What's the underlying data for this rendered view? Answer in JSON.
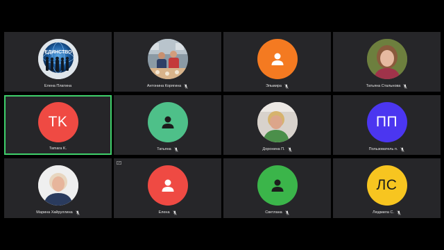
{
  "participants": [
    {
      "name": "Елена Платина",
      "avatar": "photo",
      "photo_desc": "logo-edinstvo",
      "muted": false
    },
    {
      "name": "Антонина Корягина",
      "avatar": "photo",
      "photo_desc": "people-at-table",
      "muted": true
    },
    {
      "name": "Эльмира",
      "avatar": "person-icon",
      "color": "#f47a21",
      "muted": true
    },
    {
      "name": "Татьяна Стальнова",
      "avatar": "photo",
      "photo_desc": "woman-portrait",
      "muted": true
    },
    {
      "name": "Tamara K.",
      "avatar": "initials",
      "initials": "TK",
      "color": "#ef4a43",
      "muted": false,
      "active_speaker": true
    },
    {
      "name": "Татьяна",
      "avatar": "person-icon",
      "color": "#4ec089",
      "muted": true
    },
    {
      "name": "Доронина П.",
      "avatar": "photo",
      "photo_desc": "woman-portrait",
      "muted": true
    },
    {
      "name": "Пользователь п.",
      "avatar": "initials",
      "initials": "ПП",
      "color": "#4b36f0",
      "muted": true
    },
    {
      "name": "Марина Хайруллина",
      "avatar": "photo",
      "photo_desc": "woman-portrait",
      "muted": true
    },
    {
      "name": "Елена",
      "avatar": "person-icon",
      "color": "#ef4a43",
      "muted": true
    },
    {
      "name": "Светлана",
      "avatar": "person-icon",
      "color": "#3bb54a",
      "muted": true
    },
    {
      "name": "Людмила С.",
      "avatar": "initials",
      "initials": "ЛС",
      "color": "#f7c520",
      "muted": true
    }
  ],
  "logo_text": "ЕДИНСТВО",
  "colors": {
    "background": "#000000",
    "tile": "#262629",
    "active_border": "#3fd06b"
  }
}
